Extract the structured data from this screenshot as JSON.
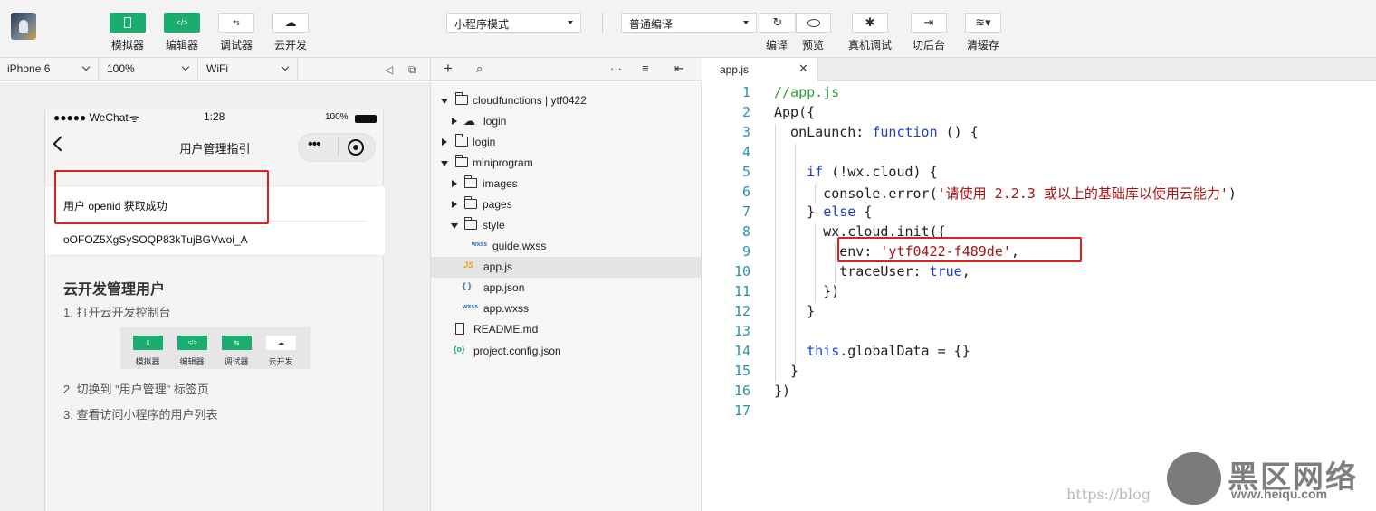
{
  "toolbar": {
    "simulator": "模拟器",
    "editor": "编辑器",
    "debugger": "调试器",
    "cloud": "云开发",
    "mode": "小程序模式",
    "compile_mode": "普通编译",
    "compile": "编译",
    "preview": "预览",
    "remote_debug": "真机调试",
    "background": "切后台",
    "clear_cache": "清缓存",
    "icons": [
      "phone-icon",
      "code-icon",
      "sliders-icon",
      "cloud-icon",
      "refresh-icon",
      "eye-icon",
      "bug-icon",
      "arrow-right-icon",
      "layers-icon"
    ]
  },
  "simbar": {
    "device": "iPhone 6",
    "zoom": "100%",
    "network": "WiFi"
  },
  "phone": {
    "carrier": "●●●●● WeChat",
    "time": "1:28",
    "battery": "100%",
    "nav_title": "用户管理指引",
    "success_text": "用户 openid 获取成功",
    "openid": "oOFOZ5XgSySOQP83kTujBGVwoi_A",
    "guide_title": "云开发管理用户",
    "step1": "1. 打开云开发控制台",
    "step2": "2. 切换到 \"用户管理\" 标签页",
    "step3": "3. 查看访问小程序的用户列表",
    "mini_labels": [
      "模拟器",
      "编辑器",
      "调试器",
      "云开发"
    ]
  },
  "filetree": {
    "nodes": [
      {
        "name": "cloudfunctions | ytf0422"
      },
      {
        "name": "login"
      },
      {
        "name": "login"
      },
      {
        "name": "miniprogram"
      },
      {
        "name": "images"
      },
      {
        "name": "pages"
      },
      {
        "name": "style"
      },
      {
        "name": "guide.wxss",
        "tag": "wxss"
      },
      {
        "name": "app.js",
        "tag": "JS"
      },
      {
        "name": "app.json",
        "tag": "{ }"
      },
      {
        "name": "app.wxss",
        "tag": "wxss"
      },
      {
        "name": "README.md"
      },
      {
        "name": "project.config.json",
        "tag": "{o}"
      }
    ]
  },
  "editor": {
    "tab": "app.js",
    "line_numbers": [
      "1",
      "2",
      "3",
      "4",
      "5",
      "6",
      "7",
      "8",
      "9",
      "10",
      "11",
      "12",
      "13",
      "14",
      "15",
      "16",
      "17"
    ],
    "code": {
      "l1": "//app.js",
      "l2": "App({",
      "l3_a": "  onLaunch: ",
      "l3_b": "function",
      "l3_c": " () {",
      "l5_a": "    ",
      "l5_b": "if",
      "l5_c": " (!wx.cloud) {",
      "l6_a": "      console.error(",
      "l6_b": "'请使用 2.2.3 或以上的基础库以使用云能力'",
      "l6_c": ")",
      "l7_a": "    } ",
      "l7_b": "else",
      "l7_c": " {",
      "l8": "      wx.cloud.init({",
      "l9_a": "        env: ",
      "l9_b": "'ytf0422-f489de'",
      "l9_c": ",",
      "l10_a": "        traceUser: ",
      "l10_b": "true",
      "l10_c": ",",
      "l11": "      })",
      "l12": "    }",
      "l14_a": "    ",
      "l14_b": "this",
      "l14_c": ".globalData = {}",
      "l15": "  }",
      "l16": "})"
    }
  },
  "watermark": {
    "brand": "黑区网络",
    "url": "https://blog",
    "sub": "www.heiqu.com"
  }
}
